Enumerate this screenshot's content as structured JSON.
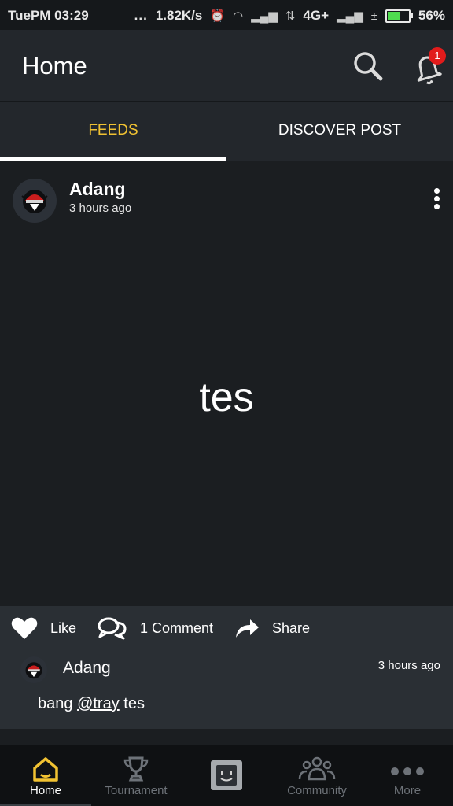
{
  "status_bar": {
    "time": "TuePM 03:29",
    "dots": "...",
    "speed": "1.82K/s",
    "network": "4G+",
    "battery": "56%",
    "battery_level": 0.56
  },
  "app_bar": {
    "title": "Home",
    "notification_count": "1"
  },
  "tabs": [
    {
      "label": "FEEDS",
      "active": true
    },
    {
      "label": "DISCOVER POST",
      "active": false
    }
  ],
  "post": {
    "author": "Adang",
    "time": "3 hours ago",
    "body": "tes",
    "actions": {
      "like": "Like",
      "comment": "1 Comment",
      "share": "Share"
    },
    "comment": {
      "author": "Adang",
      "time": "3 hours ago",
      "text_prefix": "bang",
      "mention": "@tray",
      "text_suffix": "tes"
    }
  },
  "bottom_nav": [
    {
      "label": "Home",
      "icon": "home-icon",
      "active": true
    },
    {
      "label": "Tournament",
      "icon": "trophy-icon",
      "active": false
    },
    {
      "label": "",
      "icon": "face-icon",
      "active": false
    },
    {
      "label": "Community",
      "icon": "community-icon",
      "active": false
    },
    {
      "label": "More",
      "icon": "more-dots-icon",
      "active": false
    }
  ],
  "colors": {
    "accent": "#f1c232",
    "badge": "#e21b1b",
    "background": "#1b1e21",
    "surface": "#23272c"
  }
}
